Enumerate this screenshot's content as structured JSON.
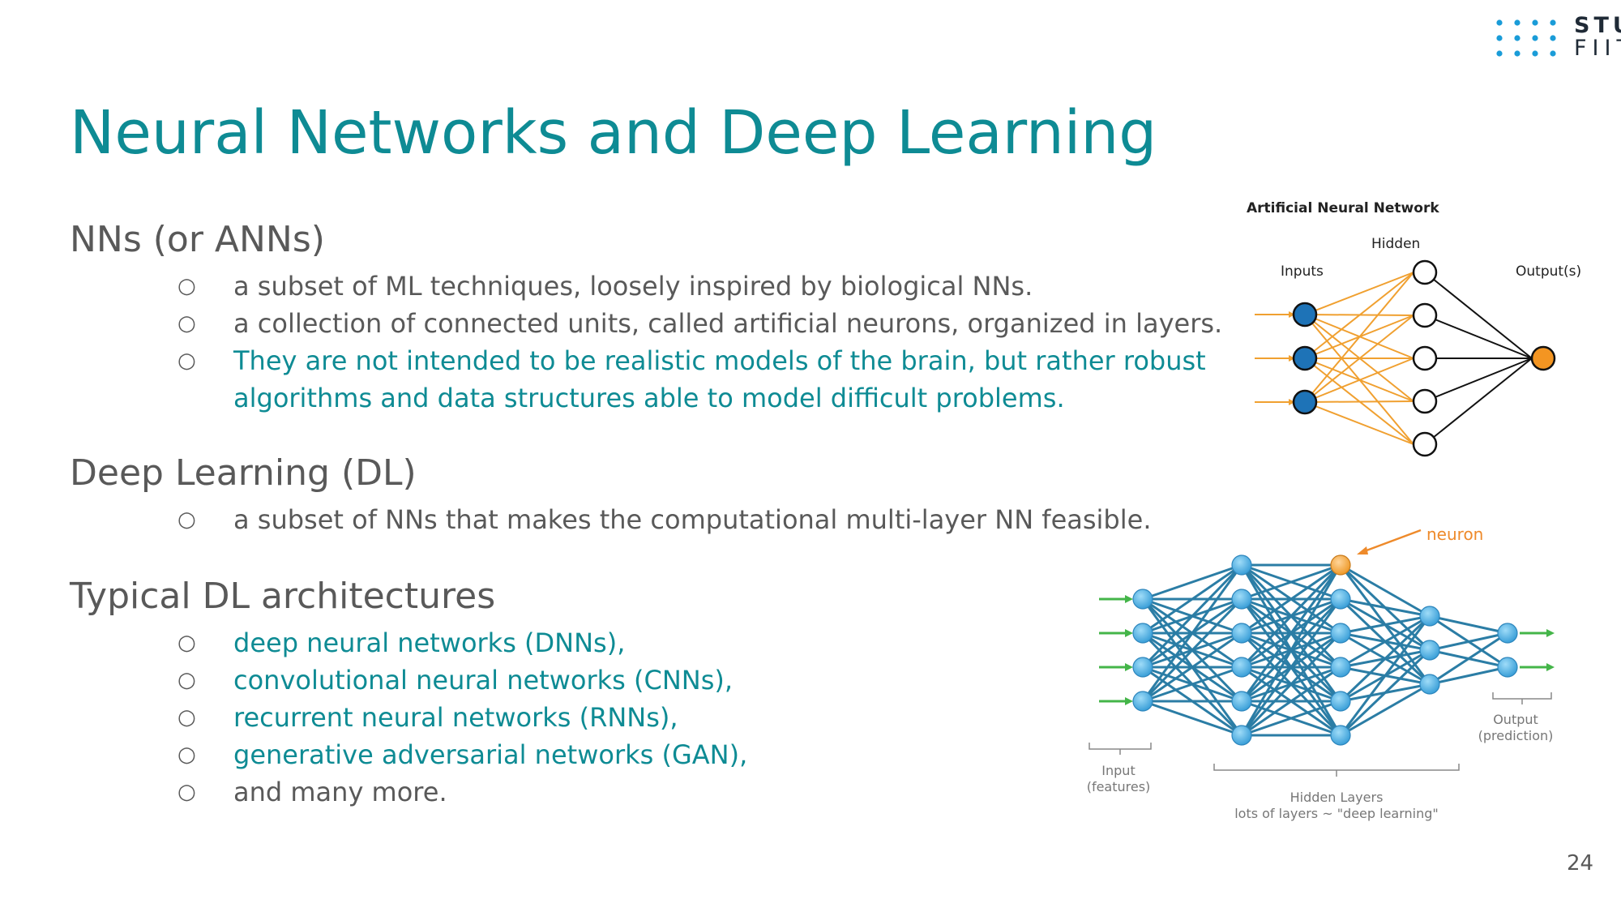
{
  "logo": {
    "line1": "STU",
    "line2": "FIIT"
  },
  "title": "Neural Networks and Deep Learning",
  "sections": [
    {
      "heading": "NNs (or ANNs)",
      "bullets": [
        "a subset of ML techniques, loosely inspired by biological NNs.",
        "a collection of connected units, called artificial neurons, organized in layers.",
        "They are not intended to be realistic models of the brain, but rather robust",
        "algorithms and data structures able to model difficult problems."
      ]
    },
    {
      "heading": "Deep Learning (DL)",
      "bullets": [
        "a subset of NNs that makes the computational multi-layer NN feasible."
      ]
    },
    {
      "heading": "Typical DL architectures",
      "bullets": [
        "deep neural networks (DNNs),",
        "convolutional neural networks (CNNs),",
        "recurrent neural networks (RNNs),",
        "generative adversarial networks (GAN),",
        "and many more."
      ]
    }
  ],
  "bullet_marker": "○",
  "ann_figure": {
    "title": "Artificial Neural Network",
    "inputs_label": "Inputs",
    "hidden_label": "Hidden",
    "outputs_label": "Output(s)"
  },
  "dl_figure": {
    "neuron_label": "neuron",
    "input_label_1": "Input",
    "input_label_2": "(features)",
    "hidden_label_1": "Hidden Layers",
    "hidden_label_2": "lots of layers ~ \"deep learning\"",
    "output_label_1": "Output",
    "output_label_2": "(prediction)"
  },
  "page_number": "24",
  "colors": {
    "teal": "#0e8b94",
    "gray_text": "#595959",
    "ann_input_node": "#1e73b7",
    "ann_output_node": "#f39522",
    "ann_edge": "#f0a030",
    "dl_node": "#4aaee6",
    "dl_edge": "#2b7da5",
    "dl_highlight": "#f2a23a",
    "dl_arrow_in": "#44b549",
    "logo_dots": "#1a9cd8"
  }
}
